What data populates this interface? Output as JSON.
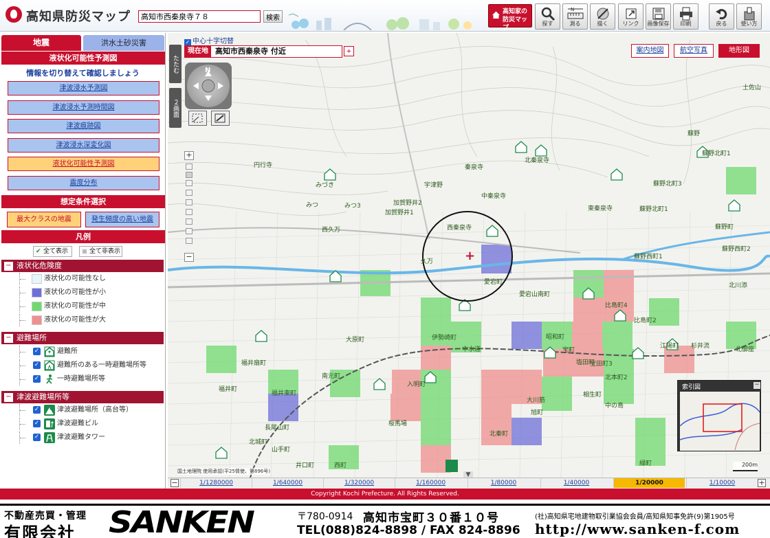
{
  "header": {
    "app_title": "高知県防災マップ",
    "search_value": "高知市西秦泉寺７８",
    "search_button": "検索",
    "bousai_button": [
      "高知家の",
      "防災マップ"
    ],
    "tools": [
      {
        "label": "探す",
        "icon": "search-icon"
      },
      {
        "label": "測る",
        "icon": "measure-icon"
      },
      {
        "label": "描く",
        "icon": "draw-icon"
      },
      {
        "label": "リンク",
        "icon": "link-icon"
      },
      {
        "label": "画像保存",
        "icon": "image-save-icon"
      },
      {
        "label": "印刷",
        "icon": "print-icon"
      },
      {
        "label": "戻る",
        "icon": "back-icon"
      },
      {
        "label": "使い方",
        "icon": "help-icon"
      }
    ]
  },
  "sidebar": {
    "tabs": {
      "jishin": "地震",
      "kozui": "洪水土砂災害"
    },
    "map_title": "液状化可能性予測図",
    "info_text": "情報を切り替えて確認しましょう",
    "map_buttons": [
      {
        "label": "津波浸水予測図",
        "active": false
      },
      {
        "label": "津波浸水予測時間図",
        "active": false
      },
      {
        "label": "津波痕跡図",
        "active": false
      },
      {
        "label": "津波浸水深変化図",
        "active": false
      },
      {
        "label": "液状化可能性予測図",
        "active": true
      },
      {
        "label": "震度分布",
        "active": false
      }
    ],
    "condition_title": "想定条件選択",
    "conditions": {
      "max": "最大クラスの地震",
      "frequent": "発生頻度の高い地震"
    },
    "legend_title": "凡例",
    "show_all": "全て表示",
    "hide_all": "全て非表示",
    "liquefaction": {
      "title": "液状化危険度",
      "items": [
        {
          "label": "液状化の可能性なし",
          "color": "#e6f6fb"
        },
        {
          "label": "液状化の可能性が小",
          "color": "#6f6fd9"
        },
        {
          "label": "液状化の可能性が中",
          "color": "#6fd96f"
        },
        {
          "label": "液状化の可能性が大",
          "color": "#f08f8f"
        }
      ]
    },
    "evacuation": {
      "title": "避難場所",
      "items": [
        {
          "label": "避難所",
          "icon": "shelter-icon"
        },
        {
          "label": "避難所のある一時避難場所等",
          "icon": "shelter-with-evac-icon"
        },
        {
          "label": "一時避難場所等",
          "icon": "temporary-evac-icon"
        }
      ]
    },
    "tsunami": {
      "title": "津波避難場所等",
      "items": [
        {
          "label": "津波避難場所（高台等）",
          "icon": "tsunami-high-ground-icon"
        },
        {
          "label": "津波避難ビル",
          "icon": "tsunami-building-icon"
        },
        {
          "label": "津波避難タワー",
          "icon": "tsunami-tower-icon"
        }
      ]
    }
  },
  "map": {
    "collapse": "たたむ",
    "split": "２画面",
    "center_cross": "中心十字切替",
    "location_label": "現在地",
    "location_value": "高知市西秦泉寺 付近",
    "map_types": [
      {
        "label": "案内地図",
        "active": false
      },
      {
        "label": "航空写真",
        "active": false
      },
      {
        "label": "地形図",
        "active": true
      }
    ],
    "compass_n": "N",
    "attribution": "国土地理院 使用承認(平25情使、第896号)",
    "scalebar": "200m",
    "overview_title": "索引図",
    "overview_close": "−",
    "place_labels": [
      "土佐山",
      "蘇野",
      "蘇野北町1",
      "北秦泉寺",
      "蘇野北町3",
      "秦泉寺",
      "中秦泉寺",
      "加賀野井2",
      "加賀野井1",
      "東秦泉寺",
      "蘇野北町1",
      "蘇野町",
      "西久万",
      "西秦泉寺",
      "蘇野西町1",
      "蘇野西町2",
      "宇津野",
      "久万",
      "愛宕町",
      "愛宕山南町",
      "比島町4",
      "比島町2",
      "北川添",
      "福井扇町",
      "大原町",
      "伊勢崎町",
      "中水道",
      "昭和町",
      "宝町",
      "塩田町",
      "江陽町",
      "杉井流",
      "北御座",
      "福井東町",
      "福井町",
      "入明町",
      "宝田町3",
      "北本町2",
      "相生町",
      "旭町",
      "南元町",
      "長尾山町",
      "北城町",
      "桜馬場",
      "大川筋",
      "北秦町",
      "山手町",
      "井口町",
      "西町",
      "中の島",
      "緑町",
      "円行寺",
      "みつ",
      "みつ3",
      "みづき"
    ],
    "scales": [
      "1/1280000",
      "1/640000",
      "1/320000",
      "1/160000",
      "1/80000",
      "1/40000",
      "1/20000",
      "1/10000"
    ],
    "active_scale": "1/20000"
  },
  "footer": {
    "copyright": "Copyright Kochi Prefecture. All Rights Reserved."
  },
  "ad": {
    "line1": "不動産売買・管理",
    "line2": "有限会社",
    "brand": "SANKEN",
    "postal": "〒780-0914",
    "address": "高知市宝町３０番１０号",
    "tel": "TEL(088)824-8898 / FAX 824-8896",
    "assoc": "(社)高知県宅地建物取引業協会会員/高知県知事免許(9)第1905号",
    "url": "http://www.sanken-f.com"
  },
  "colors": {
    "accent": "#c8102e",
    "link": "#1a3f9c",
    "active_scale": "#f6b800"
  }
}
